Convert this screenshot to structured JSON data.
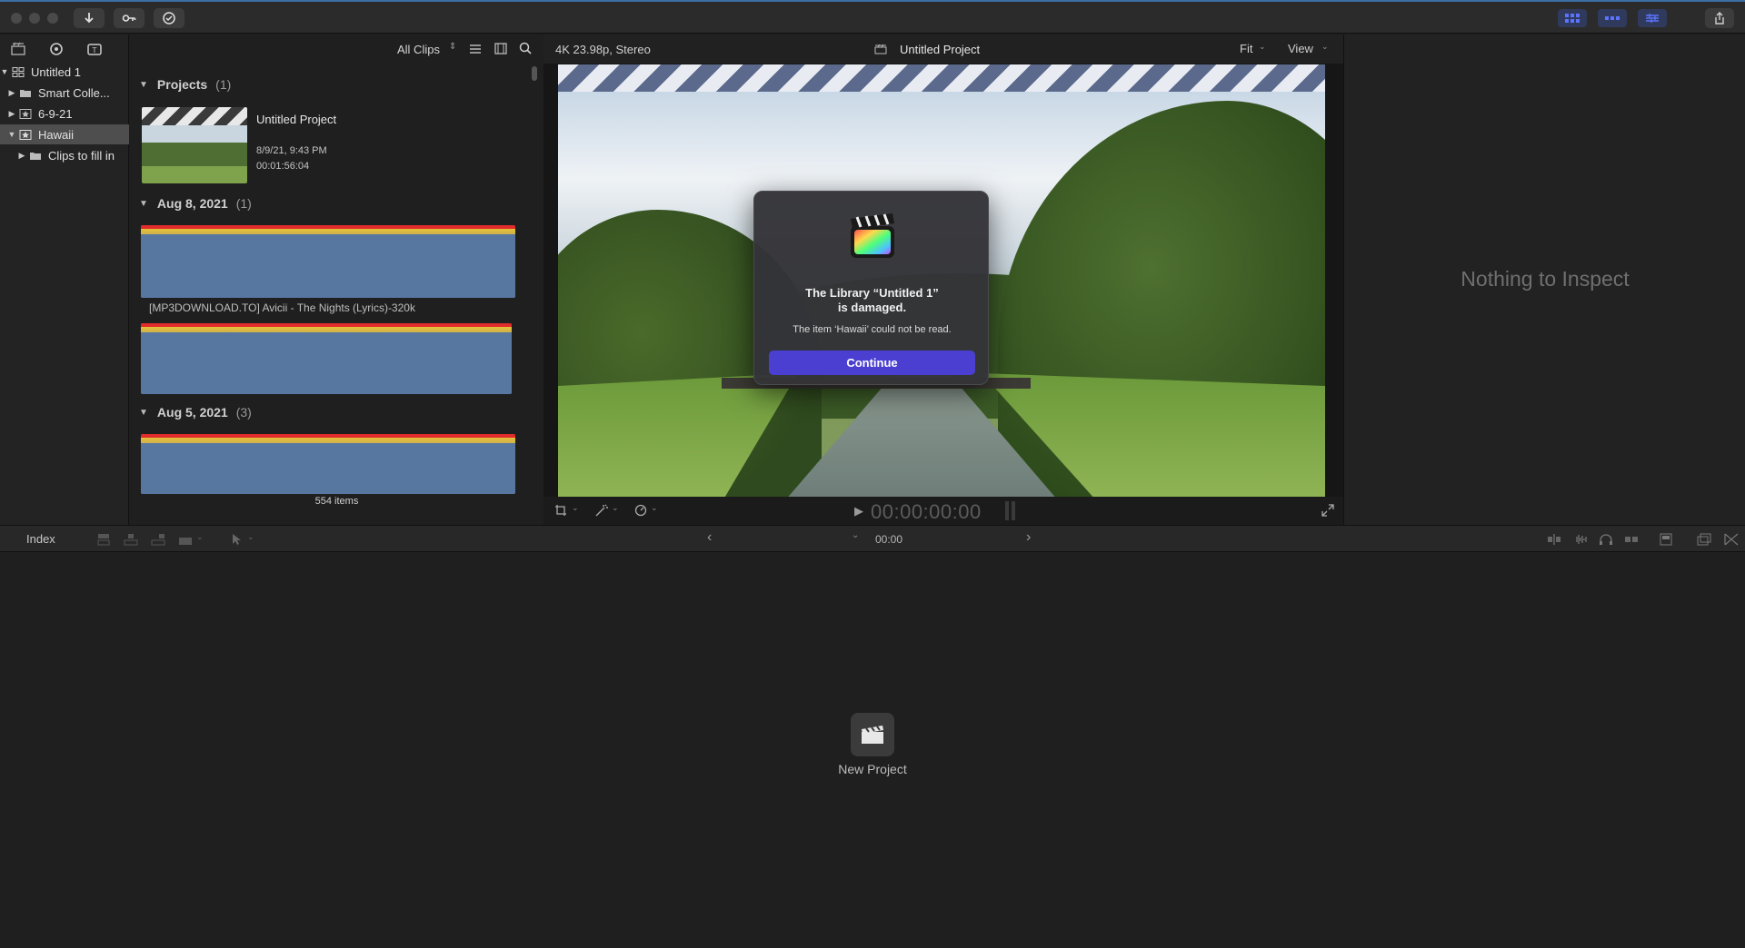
{
  "toolbar": {
    "import_icon": "download-arrow-icon",
    "keywords_icon": "key-icon",
    "background_tasks_icon": "checkmark-circle-icon",
    "layout_icons": [
      "browser-layout-icon",
      "timeline-layout-icon",
      "inspector-layout-icon"
    ],
    "share_icon": "share-icon",
    "accent_color": "#3a4ad8"
  },
  "libraries": {
    "rows": [
      {
        "label": "Untitled 1",
        "expanded": true
      },
      {
        "label": "Smart Colle...",
        "expanded": false
      },
      {
        "label": "6-9-21",
        "expanded": false
      },
      {
        "label": "Hawaii",
        "expanded": true,
        "selected": true
      },
      {
        "label": "Clips to fill in",
        "expanded": false
      }
    ]
  },
  "browser": {
    "filter_label": "All Clips",
    "sections": [
      {
        "title": "Projects",
        "count": "(1)"
      },
      {
        "title": "Aug 8, 2021",
        "count": "(1)"
      },
      {
        "title": "Aug 5, 2021",
        "count": "(3)"
      }
    ],
    "project": {
      "name": "Untitled Project",
      "date": "8/9/21, 9:43 PM",
      "duration": "00:01:56:04"
    },
    "clip_name": "[MP3DOWNLOAD.TO] Avicii - The Nights (Lyrics)-320k",
    "items_count": "554 items"
  },
  "viewer": {
    "format": "4K 23.98p, Stereo",
    "project_title": "Untitled Project",
    "fit_label": "Fit",
    "view_label": "View",
    "timecode": "00:00:00:00"
  },
  "dialog": {
    "title_line1": "The Library “Untitled 1”",
    "title_line2": "is damaged.",
    "message": "The item ‘Hawaii’ could not be read.",
    "button": "Continue",
    "button_color": "#4a3fd1"
  },
  "inspector": {
    "message": "Nothing to Inspect"
  },
  "timeline": {
    "index_label": "Index",
    "timecode": "00:00",
    "new_project_label": "New Project"
  }
}
